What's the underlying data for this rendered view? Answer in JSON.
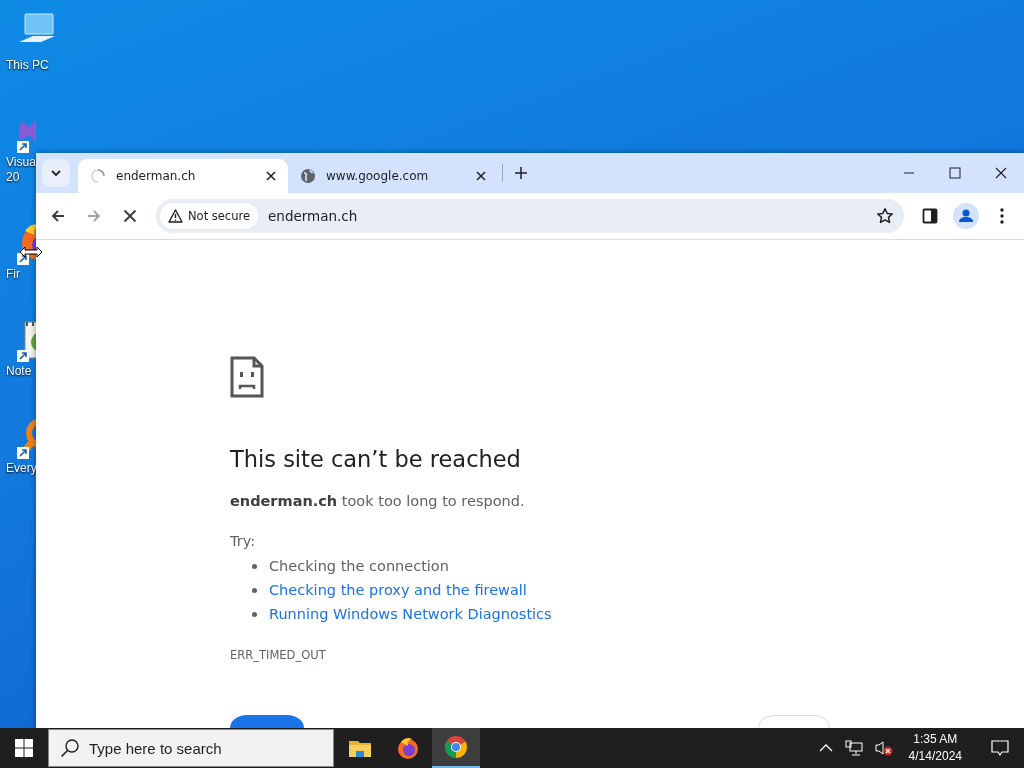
{
  "desktop_icons": [
    {
      "kind": "computer",
      "label_lines": [
        "This PC"
      ]
    },
    {
      "kind": "ide",
      "label_lines": [
        "Visual",
        "20"
      ]
    },
    {
      "kind": "firefox",
      "label_lines": [
        "Fir"
      ]
    },
    {
      "kind": "notepad",
      "label_lines": [
        "Note"
      ]
    },
    {
      "kind": "everything",
      "label_lines": [
        "Every"
      ]
    }
  ],
  "browser": {
    "tabs": [
      {
        "title": "enderman.ch",
        "selected": true,
        "loading": true
      },
      {
        "title": "www.google.com",
        "selected": false,
        "loading": false
      }
    ],
    "toolbar": {
      "security_chip": "Not secure",
      "url": "enderman.ch",
      "loading": true
    },
    "page": {
      "heading": "This site can’t be reached",
      "message": "**enderman.ch** took too long to respond.",
      "try_label": "Try:",
      "suggestions": [
        {
          "text": "Checking the connection",
          "kind": "text"
        },
        {
          "text": "Checking the proxy and the firewall",
          "kind": "link"
        },
        {
          "text": "Running Windows Network Diagnostics",
          "kind": "link"
        }
      ],
      "error_code": "ERR_TIMED_OUT",
      "buttons": [
        {
          "kind": "primary"
        },
        {
          "kind": "secondary"
        }
      ]
    }
  },
  "taskbar": {
    "search_placeholder": "Type here to search",
    "apps": [
      {
        "kind": "folder",
        "selected": false
      },
      {
        "kind": "firefox",
        "selected": false
      },
      {
        "kind": "chrome",
        "selected": true
      }
    ],
    "time": "1:35 AM",
    "date": "4/14/2024"
  }
}
